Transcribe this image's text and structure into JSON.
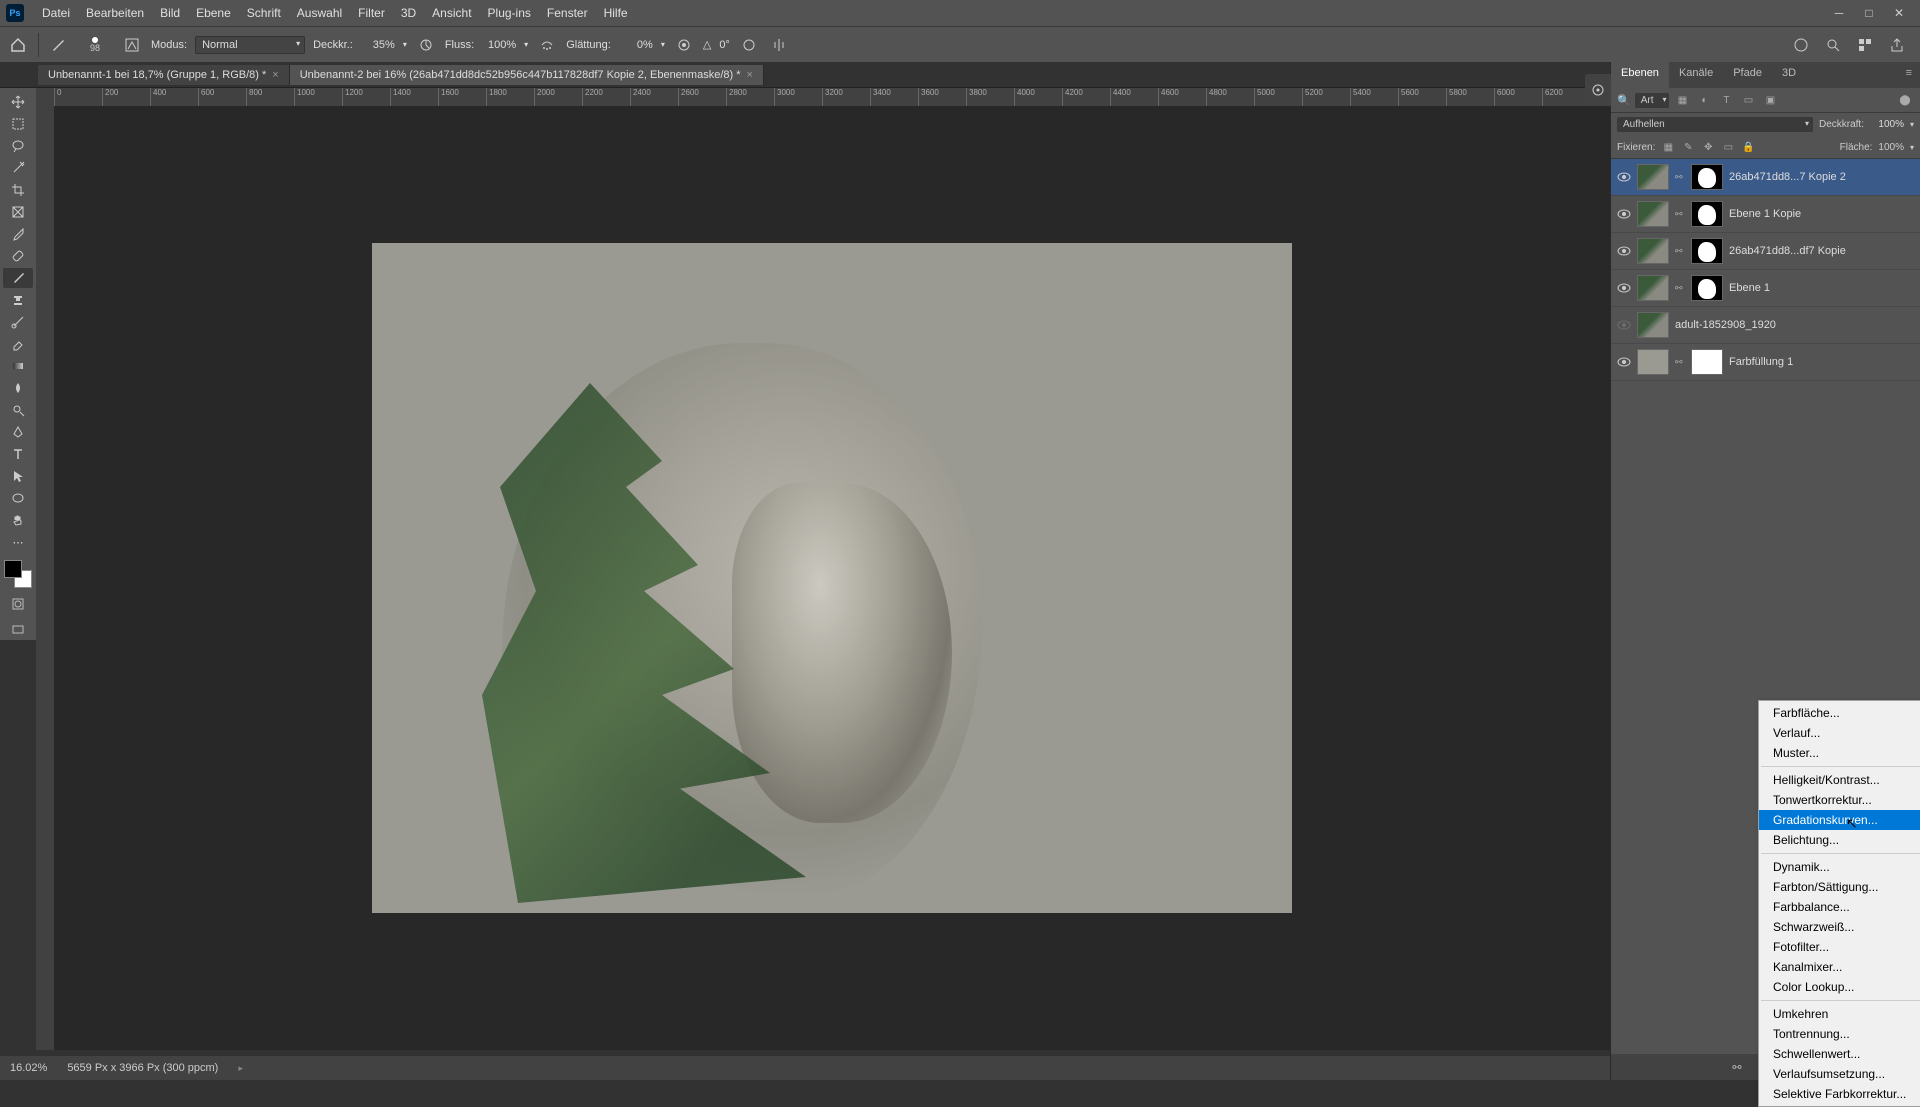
{
  "app": {
    "logo_text": "Ps"
  },
  "menu": [
    "Datei",
    "Bearbeiten",
    "Bild",
    "Ebene",
    "Schrift",
    "Auswahl",
    "Filter",
    "3D",
    "Ansicht",
    "Plug-ins",
    "Fenster",
    "Hilfe"
  ],
  "options": {
    "brush_size": "98",
    "mode_label": "Modus:",
    "mode_value": "Normal",
    "opacity_label": "Deckkr.:",
    "opacity_value": "35%",
    "flow_label": "Fluss:",
    "flow_value": "100%",
    "smoothing_label": "Glättung:",
    "smoothing_value": "0%",
    "angle_icon": "△",
    "angle_value": "0°"
  },
  "tabs": [
    {
      "label": "Unbenannt-1 bei 18,7% (Gruppe 1, RGB/8) *"
    },
    {
      "label": "Unbenannt-2 bei 16% (26ab471dd8dc52b956c447b117828df7 Kopie 2, Ebenenmaske/8) *"
    }
  ],
  "ruler_ticks": [
    "0",
    "200",
    "400",
    "600",
    "800",
    "1000",
    "1200",
    "1400",
    "1600",
    "1800",
    "2000",
    "2200",
    "2400",
    "2600",
    "2800",
    "3000",
    "3200",
    "3400",
    "3600",
    "3800",
    "4000",
    "4200",
    "4400",
    "4600",
    "4800",
    "5000",
    "5200",
    "5400",
    "5600",
    "5800",
    "6000",
    "6200"
  ],
  "status": {
    "zoom": "16.02%",
    "doc_info": "5659 Px x 3966 Px (300 ppcm)"
  },
  "panels": {
    "tabs": [
      "Ebenen",
      "Kanäle",
      "Pfade",
      "3D"
    ],
    "search_placeholder": "Art",
    "blend_mode": "Aufhellen",
    "opacity_label": "Deckkraft:",
    "opacity_value": "100%",
    "lock_label": "Fixieren:",
    "fill_label": "Fläche:",
    "fill_value": "100%"
  },
  "layers": [
    {
      "visible": true,
      "has_mask": true,
      "name": "26ab471dd8...7 Kopie 2",
      "selected": true
    },
    {
      "visible": true,
      "has_mask": true,
      "name": "Ebene 1 Kopie",
      "selected": false
    },
    {
      "visible": true,
      "has_mask": true,
      "name": "26ab471dd8...df7 Kopie",
      "selected": false
    },
    {
      "visible": true,
      "has_mask": true,
      "name": "Ebene 1",
      "selected": false
    },
    {
      "visible": false,
      "has_mask": false,
      "name": "adult-1852908_1920",
      "selected": false
    },
    {
      "visible": true,
      "has_mask": true,
      "name": "Farbfüllung 1",
      "selected": false,
      "solid": true
    }
  ],
  "context_menu": {
    "groups": [
      [
        "Farbfläche...",
        "Verlauf...",
        "Muster..."
      ],
      [
        "Helligkeit/Kontrast...",
        "Tonwertkorrektur...",
        "Gradationskurven...",
        "Belichtung..."
      ],
      [
        "Dynamik...",
        "Farbton/Sättigung...",
        "Farbbalance...",
        "Schwarzweiß...",
        "Fotofilter...",
        "Kanalmixer...",
        "Color Lookup..."
      ],
      [
        "Umkehren",
        "Tontrennung...",
        "Schwellenwert...",
        "Verlaufsumsetzung...",
        "Selektive Farbkorrektur..."
      ]
    ],
    "highlighted": "Gradationskurven..."
  }
}
